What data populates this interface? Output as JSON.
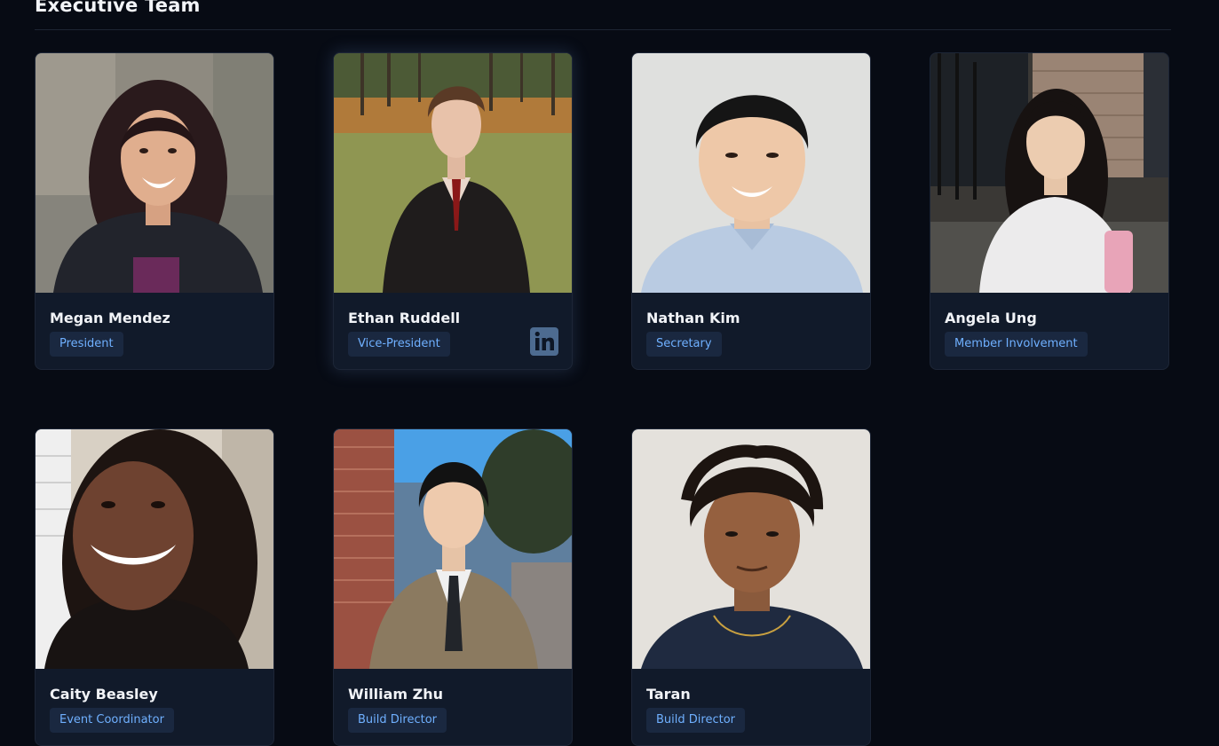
{
  "section": {
    "title": "Executive Team"
  },
  "members": [
    {
      "name": "Megan Mendez",
      "role": "President",
      "linkedin": false
    },
    {
      "name": "Ethan Ruddell",
      "role": "Vice-President",
      "linkedin": true
    },
    {
      "name": "Nathan Kim",
      "role": "Secretary",
      "linkedin": false
    },
    {
      "name": "Angela Ung",
      "role": "Member Involvement",
      "linkedin": false
    },
    {
      "name": "Caity Beasley",
      "role": "Event Coordinator",
      "linkedin": false
    },
    {
      "name": "William Zhu",
      "role": "Build Director",
      "linkedin": false
    },
    {
      "name": "Taran",
      "role": "Build Director",
      "linkedin": false
    }
  ],
  "icons": {
    "linkedin": "linkedin-icon"
  },
  "colors": {
    "background": "#070b14",
    "card": "#111a2a",
    "role_text": "#6fb0ff",
    "role_bg": "#1a2840",
    "linkedin": "#4d6b90"
  }
}
